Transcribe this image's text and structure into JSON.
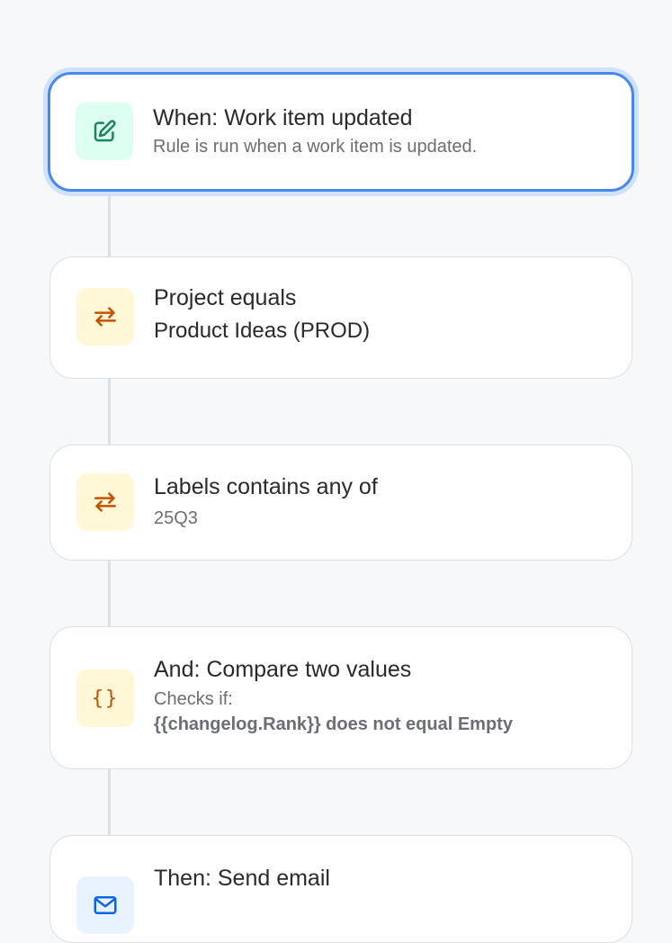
{
  "colors": {
    "background": "#f7f8f9",
    "selected_border": "#4688ec",
    "trigger_icon_bg": "#dcfff1",
    "trigger_icon": "#1f845a",
    "condition_icon_bg": "#fff7d6",
    "condition_icon": "#c25100",
    "action_icon_bg": "#e9f2ff",
    "action_icon": "#0c66e4"
  },
  "rule_steps": [
    {
      "icon": "edit-icon",
      "title": "When: Work item updated",
      "subtitle": "Rule is run when a work item is updated."
    },
    {
      "icon": "condition-arrows-icon",
      "title": "Project equals",
      "subtitle": "Product Ideas (PROD)"
    },
    {
      "icon": "condition-arrows-icon",
      "title": "Labels contains any of",
      "subtitle": "25Q3"
    },
    {
      "icon": "braces-icon",
      "icon_glyph": "{}",
      "title": "And: Compare two values",
      "subtitle": "Checks if:",
      "detail": "{{changelog.Rank}} does not equal Empty"
    },
    {
      "icon": "email-icon",
      "title": "Then: Send email"
    }
  ]
}
